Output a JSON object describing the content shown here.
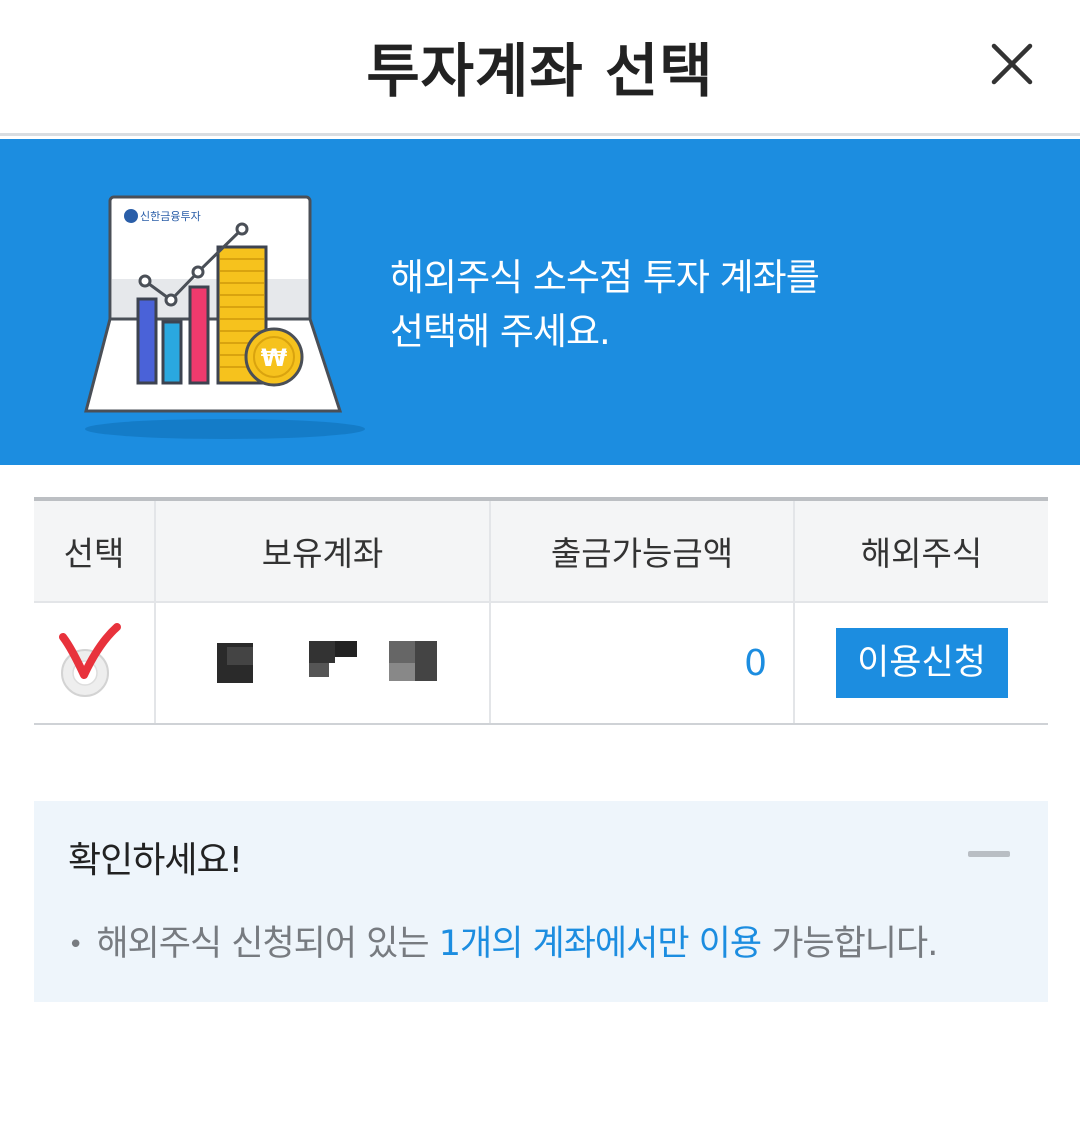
{
  "header": {
    "title": "투자계좌 선택",
    "close_icon": "close-icon"
  },
  "banner": {
    "illustration": {
      "brand_text": "신한금융투자",
      "currency_symbol": "₩"
    },
    "message_line1": "해외주식 소수점 투자 계좌를",
    "message_line2": "선택해 주세요."
  },
  "table": {
    "headers": [
      "선택",
      "보유계좌",
      "출금가능금액",
      "해외주식"
    ],
    "rows": [
      {
        "selected": true,
        "account": "",
        "withdrawable": "0",
        "action_label": "이용신청"
      }
    ]
  },
  "notice": {
    "title": "확인하세요!",
    "bullet": "•",
    "text_before": "해외주식 신청되어 있는 ",
    "text_highlight": "1개의 계좌에서만 이용",
    "text_after": " 가능합니다."
  },
  "colors": {
    "accent": "#1c8de0",
    "check_red": "#e8323c",
    "notice_bg": "#eef5fb"
  }
}
